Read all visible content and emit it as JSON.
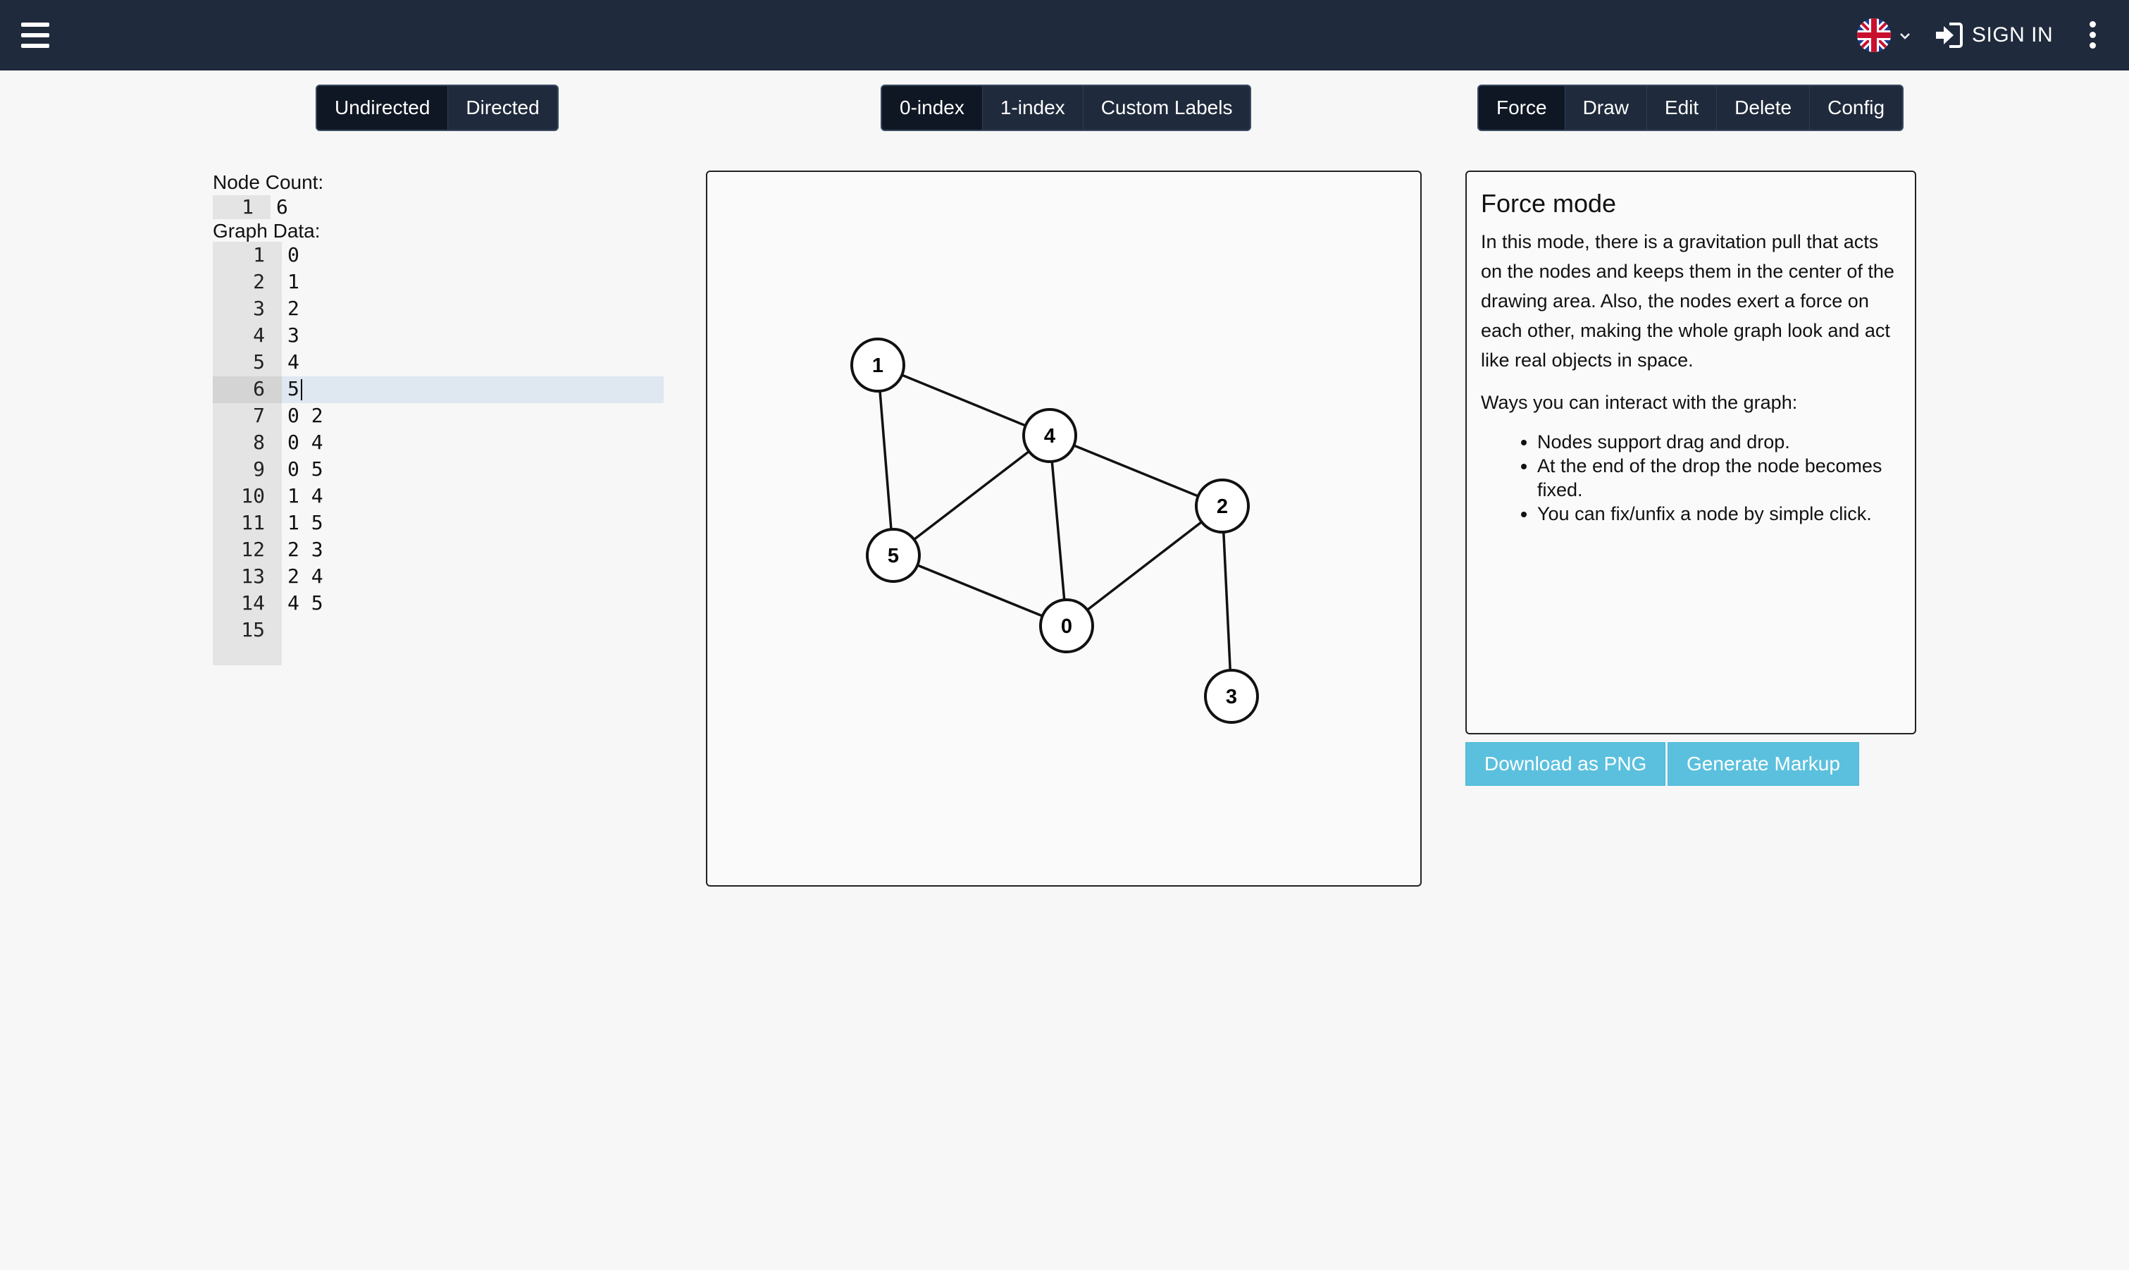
{
  "header": {
    "menu_icon": "hamburger-icon",
    "language_icon": "uk-flag-icon",
    "signin_icon": "sign-in-icon",
    "signin_label": "SIGN IN",
    "more_icon": "kebab-menu-icon",
    "bar_color": "#1f2a3c"
  },
  "direction_group": {
    "buttons": [
      {
        "label": "Undirected",
        "active": true
      },
      {
        "label": "Directed",
        "active": false
      }
    ]
  },
  "index_group": {
    "buttons": [
      {
        "label": "0-index",
        "active": true
      },
      {
        "label": "1-index",
        "active": false
      },
      {
        "label": "Custom Labels",
        "active": false
      }
    ]
  },
  "mode_group": {
    "buttons": [
      {
        "label": "Force",
        "active": true
      },
      {
        "label": "Draw",
        "active": false
      },
      {
        "label": "Edit",
        "active": false
      },
      {
        "label": "Delete",
        "active": false
      },
      {
        "label": "Config",
        "active": false
      }
    ]
  },
  "node_count": {
    "label": "Node Count:",
    "lines": [
      {
        "num": "1",
        "text": "6"
      }
    ]
  },
  "graph_data": {
    "label": "Graph Data:",
    "lines": [
      {
        "num": "1",
        "text": "0"
      },
      {
        "num": "2",
        "text": "1"
      },
      {
        "num": "3",
        "text": "2"
      },
      {
        "num": "4",
        "text": "3"
      },
      {
        "num": "5",
        "text": "4"
      },
      {
        "num": "6",
        "text": "5"
      },
      {
        "num": "7",
        "text": "0 2"
      },
      {
        "num": "8",
        "text": "0 4"
      },
      {
        "num": "9",
        "text": "0 5"
      },
      {
        "num": "10",
        "text": "1 4"
      },
      {
        "num": "11",
        "text": "1 5"
      },
      {
        "num": "12",
        "text": "2 3"
      },
      {
        "num": "13",
        "text": "2 4"
      },
      {
        "num": "14",
        "text": "4 5"
      },
      {
        "num": "15",
        "text": ""
      }
    ],
    "active_line": 6
  },
  "graph": {
    "nodes": [
      "0",
      "1",
      "2",
      "3",
      "4",
      "5"
    ],
    "edges": [
      [
        "0",
        "2"
      ],
      [
        "0",
        "4"
      ],
      [
        "0",
        "5"
      ],
      [
        "1",
        "4"
      ],
      [
        "1",
        "5"
      ],
      [
        "2",
        "3"
      ],
      [
        "2",
        "4"
      ],
      [
        "4",
        "5"
      ]
    ]
  },
  "info": {
    "title": "Force mode",
    "paragraph": "In this mode, there is a gravitation pull that acts on the nodes and keeps them in the center of the drawing area. Also, the nodes exert a force on each other, making the whole graph look and act like real objects in space.",
    "subtitle": "Ways you can interact with the graph:",
    "bullets": [
      "Nodes support drag and drop.",
      "At the end of the drop the node becomes fixed.",
      "You can fix/unfix a node by simple click."
    ]
  },
  "actions": {
    "download_label": "Download as PNG",
    "markup_label": "Generate Markup",
    "color": "#5bc0de"
  }
}
